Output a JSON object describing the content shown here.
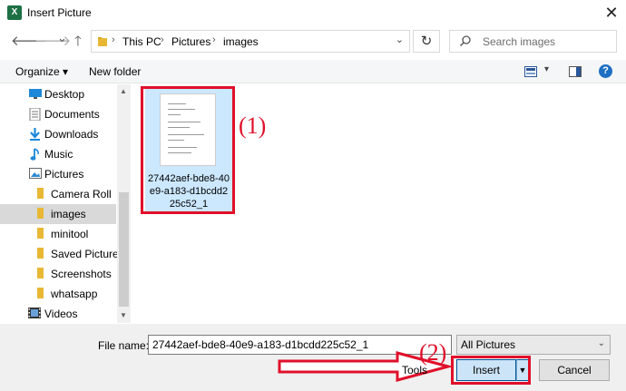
{
  "window": {
    "title": "Insert Picture",
    "app_icon": "excel-icon",
    "close_symbol": "✕"
  },
  "nav": {
    "back": "🡐",
    "forward": "🡒",
    "recent": "⌄",
    "up": "🡑",
    "breadcrumb": [
      "This PC",
      "Pictures",
      "images"
    ],
    "separator": "›",
    "dropdown": "⌄",
    "refresh": "↻",
    "search_placeholder": "Search images"
  },
  "toolbar": {
    "organize_label": "Organize ▾",
    "new_folder_label": "New folder",
    "view_dropdown": "▾",
    "help_label": "?"
  },
  "sidebar": {
    "items": [
      {
        "label": "Desktop",
        "icon": "desktop-icon",
        "level": 0,
        "selected": false
      },
      {
        "label": "Documents",
        "icon": "documents-icon",
        "level": 0,
        "selected": false
      },
      {
        "label": "Downloads",
        "icon": "downloads-icon",
        "level": 0,
        "selected": false
      },
      {
        "label": "Music",
        "icon": "music-icon",
        "level": 0,
        "selected": false
      },
      {
        "label": "Pictures",
        "icon": "pictures-icon",
        "level": 0,
        "selected": false
      },
      {
        "label": "Camera Roll",
        "icon": "folder-icon",
        "level": 1,
        "selected": false
      },
      {
        "label": "images",
        "icon": "folder-icon",
        "level": 1,
        "selected": true
      },
      {
        "label": "minitool",
        "icon": "folder-icon",
        "level": 1,
        "selected": false
      },
      {
        "label": "Saved Pictures",
        "icon": "folder-icon",
        "level": 1,
        "selected": false
      },
      {
        "label": "Screenshots",
        "icon": "folder-icon",
        "level": 1,
        "selected": false
      },
      {
        "label": "whatsapp",
        "icon": "folder-icon",
        "level": 1,
        "selected": false
      },
      {
        "label": "Videos",
        "icon": "videos-icon",
        "level": 0,
        "selected": false
      }
    ]
  },
  "files": [
    {
      "name": "27442aef-bde8-40e9-a183-d1bcdd225c52_1",
      "selected": true
    }
  ],
  "annotations": {
    "step1": "(1)",
    "step2": "(2)"
  },
  "footer": {
    "file_name_label": "File name:",
    "file_name_value": "27442aef-bde8-40e9-a183-d1bcdd225c52_1",
    "filter_value": "All Pictures",
    "tools_label": "Tools",
    "insert_label": "Insert",
    "cancel_label": "Cancel"
  },
  "colors": {
    "highlight_red": "#e0102a",
    "selection_blue": "#cce8ff",
    "primary_button": "#cce4f7",
    "folder_yellow": "#e8b835"
  }
}
